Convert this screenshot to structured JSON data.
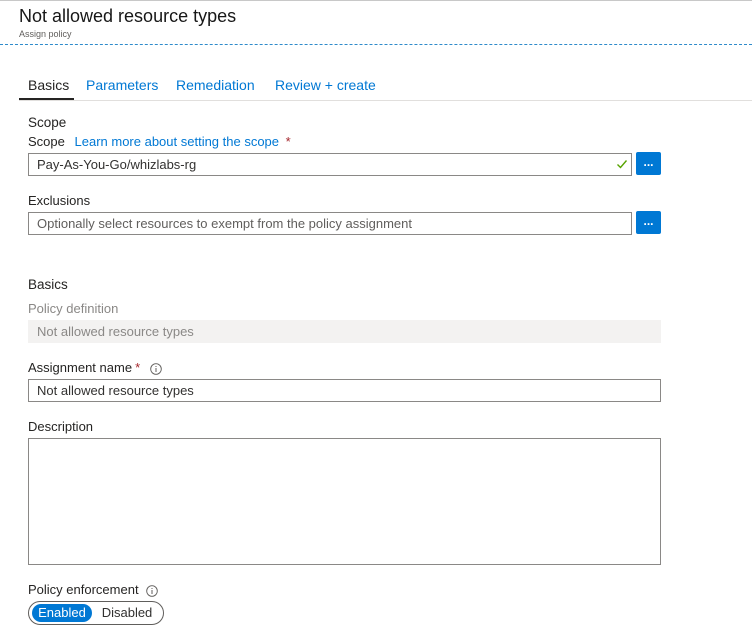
{
  "header": {
    "title": "Not allowed resource types",
    "subtitle": "Assign policy"
  },
  "tabs": [
    {
      "label": "Basics",
      "active": true
    },
    {
      "label": "Parameters",
      "active": false
    },
    {
      "label": "Remediation",
      "active": false
    },
    {
      "label": "Review + create",
      "active": false
    }
  ],
  "scope_section": {
    "title": "Scope",
    "scope_label": "Scope",
    "learn_more_link": "Learn more about setting the scope",
    "required_marker": "*",
    "scope_value": "Pay-As-You-Go/whizlabs-rg",
    "browse_label": "...",
    "exclusions_label": "Exclusions",
    "exclusions_placeholder": "Optionally select resources to exempt from the policy assignment"
  },
  "basics_section": {
    "title": "Basics",
    "policy_definition_label": "Policy definition",
    "policy_definition_value": "Not allowed resource types",
    "assignment_name_label": "Assignment name",
    "required_marker": "*",
    "assignment_name_value": "Not allowed resource types",
    "description_label": "Description",
    "description_value": "",
    "policy_enforcement_label": "Policy enforcement",
    "enforcement_options": [
      "Enabled",
      "Disabled"
    ],
    "enforcement_selected": "Enabled"
  },
  "colors": {
    "accent": "#0078d4",
    "required": "#a4262c",
    "valid_check": "#57a300"
  },
  "icons": {
    "valid": "checkmark-icon",
    "info": "info-icon"
  }
}
